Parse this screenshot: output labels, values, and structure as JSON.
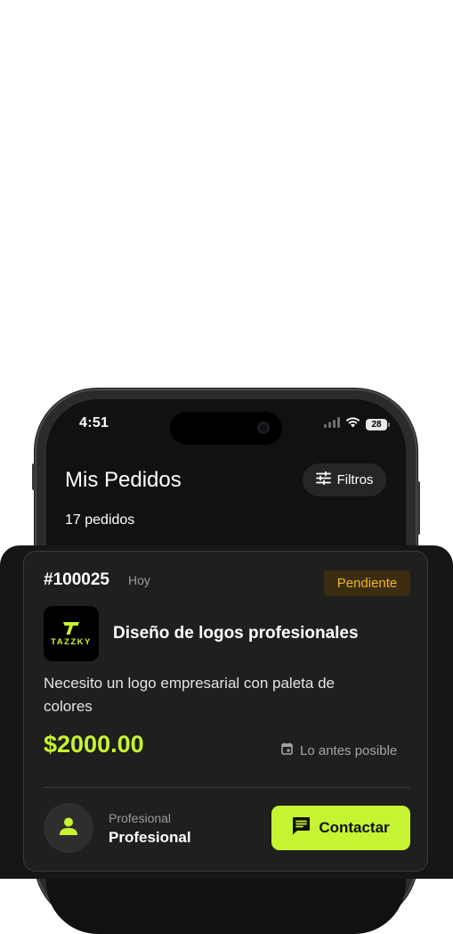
{
  "status_bar": {
    "time": "4:51",
    "battery": "28"
  },
  "header": {
    "title": "Mis Pedidos",
    "count": "17 pedidos",
    "filter_label": "Filtros"
  },
  "order": {
    "id": "#100025",
    "date": "Hoy",
    "status": "Pendiente",
    "logo_text": "TAZZKY",
    "service_title": "Diseño de logos profesionales",
    "description": "Necesito un logo empresarial con paleta de colores",
    "price": "$2000.00",
    "deadline": "Lo antes posible",
    "role_label": "Profesional",
    "role_name": "Profesional",
    "contact_label": "Contactar"
  },
  "colors": {
    "accent": "#c6f432",
    "pending": "#f0b429",
    "background": "#161616",
    "card": "#1f1f1f"
  },
  "icons": [
    "wifi-icon",
    "signal-icon",
    "battery-icon",
    "filter-icon",
    "calendar-icon",
    "person-icon",
    "chat-icon",
    "tazzky-logo"
  ]
}
